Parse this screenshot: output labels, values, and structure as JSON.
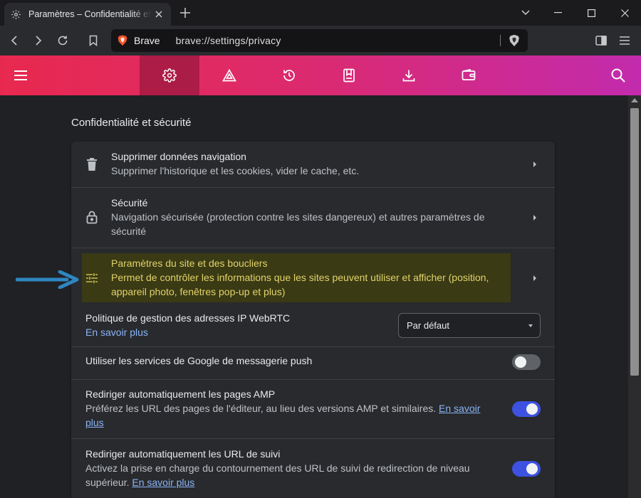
{
  "window": {
    "tab_title": "Paramètres – Confidentialité et sécurité",
    "icons": {
      "tab": "gear-icon",
      "close": "close-icon",
      "new_tab": "plus-icon",
      "minimize": "chevron-down-icon",
      "maximize": "maximize-icon",
      "restore": "restore-icon",
      "window_close": "close-icon"
    }
  },
  "toolbar": {
    "brand": "Brave",
    "url": "brave://settings/privacy",
    "icons": [
      "back-icon",
      "forward-icon",
      "reload-icon",
      "bookmark-icon",
      "brave-shield-icon",
      "sidebar-icon",
      "menu-icon"
    ]
  },
  "settings_nav": {
    "icons": [
      "hamburger-icon",
      "gear-icon",
      "rewards-triangle-icon",
      "history-icon",
      "bookmarks-icon",
      "download-icon",
      "wallet-icon",
      "search-icon"
    ],
    "active": "gear-icon"
  },
  "main": {
    "section_title": "Confidentialité et sécurité",
    "rows": {
      "clear_data": {
        "title": "Supprimer données navigation",
        "sub": "Supprimer l'historique et les cookies, vider le cache, etc."
      },
      "security": {
        "title": "Sécurité",
        "sub_line1": "Navigation sécurisée (protection contre les sites dangereux) et autres paramètres de",
        "sub_line2": "sécurité"
      },
      "site_settings": {
        "title": "Paramètres du site et des boucliers",
        "sub_line1": "Permet de contrôler les informations que les sites peuvent utiliser et afficher (position,",
        "sub_line2": "appareil photo, fenêtres pop-up et plus)"
      },
      "webrtc": {
        "title": "Politique de gestion des adresses IP WebRTC",
        "link": "En savoir plus",
        "select_value": "Par défaut"
      },
      "push": {
        "title": "Utiliser les services de Google de messagerie push",
        "enabled": false
      },
      "amp": {
        "title": "Rediriger automatiquement les pages AMP",
        "sub": "Préférez les URL des pages de l'éditeur, au lieu des versions AMP et similaires.",
        "link_part1": "En savoir",
        "link_part2": "plus",
        "enabled": true
      },
      "tracking": {
        "title": "Rediriger automatiquement les URL de suivi",
        "sub_line1": "Activez la prise en charge du contournement des URL de suivi de redirection de niveau",
        "sub_line2": "supérieur.",
        "link": "En savoir plus",
        "enabled": true
      }
    }
  },
  "colors": {
    "header_gradient_start": "#e8294f",
    "header_gradient_end": "#c22bad",
    "toggle_on": "#3d52e0",
    "link": "#8ab4f8",
    "highlight_text": "#e2d36a",
    "arrow": "#2e86c1"
  }
}
